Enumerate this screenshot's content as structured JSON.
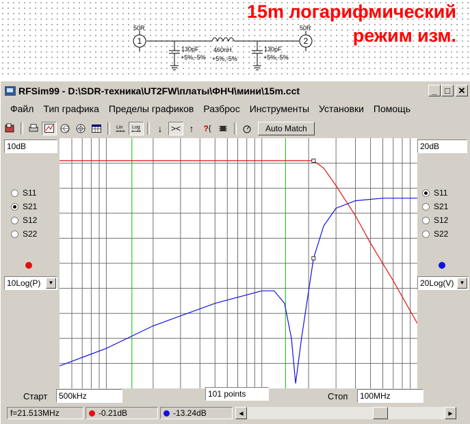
{
  "heading": {
    "line1": "15m логарифмический",
    "line2": "режим изм."
  },
  "schematic": {
    "port1_impedance": "50R",
    "port1_number": "1",
    "port2_impedance": "50R",
    "port2_number": "2",
    "cap1_value": "130pF",
    "cap1_tolerance": "+5%,-5%",
    "inductor_value": "460nH",
    "inductor_tolerance": "+5%,-5%",
    "cap2_value": "130pF",
    "cap2_tolerance": "+5%,-5%"
  },
  "window": {
    "title": "RFSim99 - D:\\SDR-техника\\UT2FW\\платы\\ФНЧ\\мини\\15m.cct",
    "minimize": "_",
    "maximize": "□",
    "close": "✕"
  },
  "menu": [
    "Файл",
    "Тип графика",
    "Пределы графиков",
    "Разброс",
    "Инструменты",
    "Установки",
    "Помощь"
  ],
  "toolbar": {
    "lin_label": "Lin",
    "log_label": "Log",
    "auto_match": "Auto Match",
    "icons": [
      "open-icon",
      "print-icon",
      "graph-icon",
      "smith-chart-icon",
      "polar-icon",
      "table-icon",
      "lin-scale-icon",
      "log-scale-icon",
      "arrow-down-icon",
      "zoom-in-icon",
      "arrow-up-icon",
      "help-icon",
      "chip-icon",
      "tune-icon"
    ]
  },
  "left_panel": {
    "scale": "10dB",
    "params": [
      {
        "label": "S11",
        "selected": false
      },
      {
        "label": "S21",
        "selected": true
      },
      {
        "label": "S12",
        "selected": false
      },
      {
        "label": "S22",
        "selected": false
      }
    ],
    "trace_color": "#e01010",
    "mode": "10Log(P)"
  },
  "right_panel": {
    "scale": "20dB",
    "params": [
      {
        "label": "S11",
        "selected": true
      },
      {
        "label": "S21",
        "selected": false
      },
      {
        "label": "S12",
        "selected": false
      },
      {
        "label": "S22",
        "selected": false
      }
    ],
    "trace_color": "#1010e0",
    "mode": "20Log(V)"
  },
  "bottom": {
    "start_label": "Старт",
    "start_value": "500kHz",
    "points": "101 points",
    "stop_label": "Стоп",
    "stop_value": "100MHz"
  },
  "status": {
    "frequency": "f=21.513MHz",
    "marker_red": "-0.21dB",
    "marker_blue": "-13.24dB"
  },
  "chart_data": {
    "type": "line",
    "x_scale": "log",
    "xlim_mhz": [
      0.5,
      100
    ],
    "grid": true,
    "series": [
      {
        "color": "#e01010",
        "x": [
          0.5,
          2,
          5,
          10,
          15,
          20,
          21.513,
          25,
          30,
          40,
          50,
          70,
          100
        ],
        "y_scale_frac": [
          0.91,
          0.91,
          0.91,
          0.91,
          0.91,
          0.91,
          0.91,
          0.88,
          0.81,
          0.69,
          0.58,
          0.43,
          0.26
        ]
      },
      {
        "color": "#1010e0",
        "x": [
          0.5,
          1,
          2,
          5,
          10,
          12,
          14,
          15.5,
          16.5,
          18,
          21.513,
          25,
          30,
          40,
          60,
          100
        ],
        "y_scale_frac": [
          0.09,
          0.16,
          0.25,
          0.34,
          0.39,
          0.39,
          0.34,
          0.2,
          0.02,
          0.2,
          0.52,
          0.65,
          0.72,
          0.75,
          0.76,
          0.76
        ]
      }
    ],
    "markers": [
      {
        "x": 21.513,
        "series": 0
      },
      {
        "x": 21.513,
        "series": 1
      }
    ],
    "limit_lines_mhz": [
      1.46,
      14.2
    ]
  }
}
